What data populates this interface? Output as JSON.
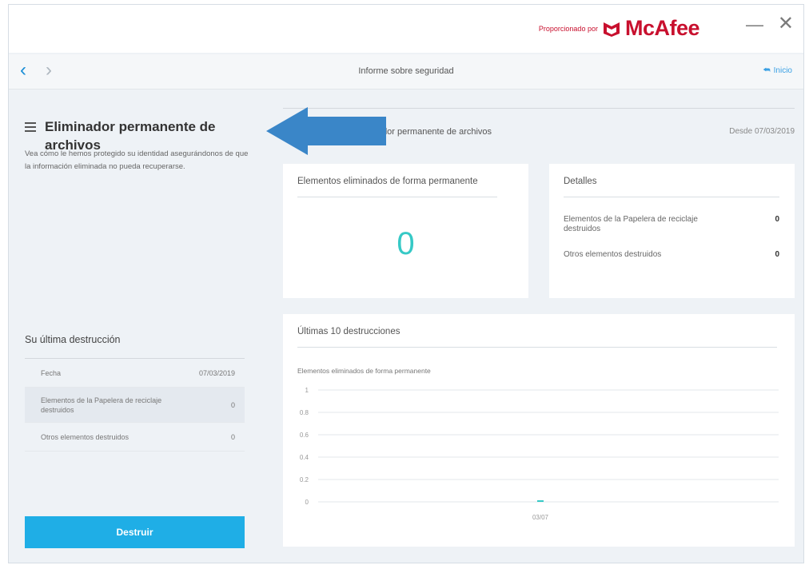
{
  "header": {
    "brand_prefix": "Proporcionado por",
    "brand_name": "McAfee",
    "minimize_glyph": "—",
    "close_glyph": "✕"
  },
  "nav": {
    "back_glyph": "‹",
    "forward_glyph": "›",
    "title": "Informe sobre seguridad",
    "home_label": "Inicio",
    "home_glyph": "⮪"
  },
  "sidebar": {
    "title": "Eliminador permanente de archivos",
    "description": "Vea cómo le hemos protegido su identidad asegurándonos de que la información eliminada no pueda recuperarse.",
    "last_title": "Su última destrucción",
    "last_rows": [
      {
        "label": "Fecha",
        "value": "07/03/2019"
      },
      {
        "label": "Elementos de la Papelera de reciclaje destruidos",
        "value": "0"
      },
      {
        "label": "Otros elementos destruidos",
        "value": "0"
      }
    ],
    "destroy_button": "Destruir"
  },
  "main": {
    "header_title": "Eliminador permanente de archivos",
    "header_date": "Desde 07/03/2019",
    "deleted_card": {
      "title": "Elementos eliminados de forma permanente",
      "value": "0"
    },
    "details_card": {
      "title": "Detalles",
      "rows": [
        {
          "label": "Elementos de la Papelera de reciclaje destruidos",
          "value": "0"
        },
        {
          "label": "Otros elementos destruidos",
          "value": "0"
        }
      ]
    },
    "chart_card": {
      "title": "Últimas 10 destrucciones",
      "subtitle": "Elementos eliminados de forma permanente"
    }
  },
  "colors": {
    "accent": "#1faee6",
    "brand": "#c8102e",
    "teal": "#36c9c6",
    "arrow": "#3a86c8"
  },
  "chart_data": {
    "type": "bar",
    "title": "Últimas 10 destrucciones",
    "subtitle": "Elementos eliminados de forma permanente",
    "categories": [
      "03/07"
    ],
    "values": [
      0
    ],
    "ylim": [
      0,
      1
    ],
    "yticks": [
      0,
      0.2,
      0.4,
      0.6,
      0.8,
      1
    ],
    "ytick_labels": [
      "0",
      "0.2",
      "0.4",
      "0.6",
      "0.8",
      "1"
    ],
    "grid": true,
    "color": "#36c9c6"
  }
}
